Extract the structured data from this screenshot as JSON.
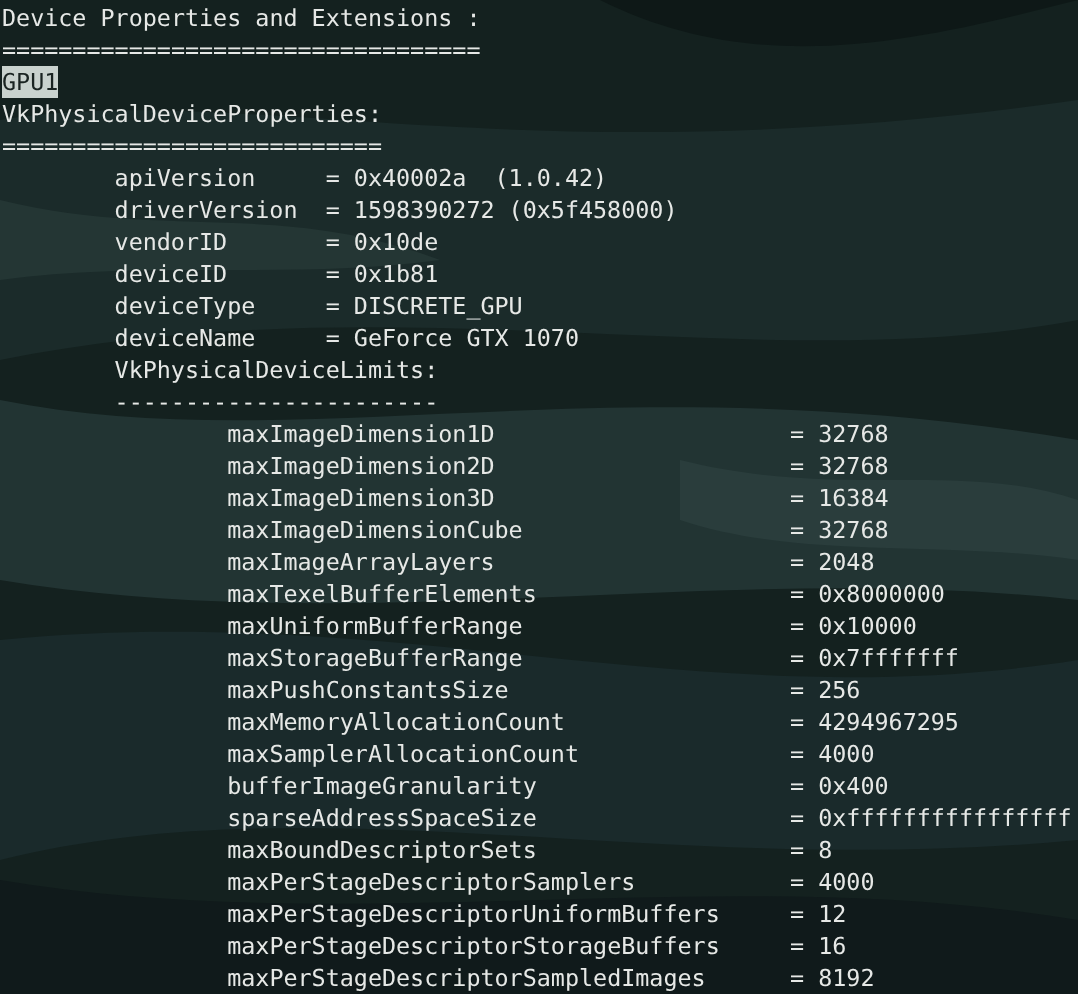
{
  "title": "Device Properties and Extensions :",
  "title_rule": "==================================",
  "gpu": {
    "label": "GPU1",
    "selected": true
  },
  "properties_heading": "VkPhysicalDeviceProperties:",
  "properties_rule": "===========================",
  "properties": [
    {
      "key": "apiVersion",
      "value": "= 0x40002a  (1.0.42)"
    },
    {
      "key": "driverVersion",
      "value": "= 1598390272 (0x5f458000)"
    },
    {
      "key": "vendorID",
      "value": "= 0x10de"
    },
    {
      "key": "deviceID",
      "value": "= 0x1b81"
    },
    {
      "key": "deviceType",
      "value": "= DISCRETE_GPU"
    },
    {
      "key": "deviceName",
      "value": "= GeForce GTX 1070"
    }
  ],
  "limits_heading": "VkPhysicalDeviceLimits:",
  "limits_rule": "-----------------------",
  "limits": [
    {
      "key": "maxImageDimension1D",
      "value": "= 32768"
    },
    {
      "key": "maxImageDimension2D",
      "value": "= 32768"
    },
    {
      "key": "maxImageDimension3D",
      "value": "= 16384"
    },
    {
      "key": "maxImageDimensionCube",
      "value": "= 32768"
    },
    {
      "key": "maxImageArrayLayers",
      "value": "= 2048"
    },
    {
      "key": "maxTexelBufferElements",
      "value": "= 0x8000000"
    },
    {
      "key": "maxUniformBufferRange",
      "value": "= 0x10000"
    },
    {
      "key": "maxStorageBufferRange",
      "value": "= 0x7fffffff"
    },
    {
      "key": "maxPushConstantsSize",
      "value": "= 256"
    },
    {
      "key": "maxMemoryAllocationCount",
      "value": "= 4294967295"
    },
    {
      "key": "maxSamplerAllocationCount",
      "value": "= 4000"
    },
    {
      "key": "bufferImageGranularity",
      "value": "= 0x400"
    },
    {
      "key": "sparseAddressSpaceSize",
      "value": "= 0xffffffffffffffff"
    },
    {
      "key": "maxBoundDescriptorSets",
      "value": "= 8"
    },
    {
      "key": "maxPerStageDescriptorSamplers",
      "value": "= 4000"
    },
    {
      "key": "maxPerStageDescriptorUniformBuffers",
      "value": "= 12"
    },
    {
      "key": "maxPerStageDescriptorStorageBuffers",
      "value": "= 16"
    },
    {
      "key": "maxPerStageDescriptorSampledImages",
      "value": "= 8192"
    }
  ]
}
